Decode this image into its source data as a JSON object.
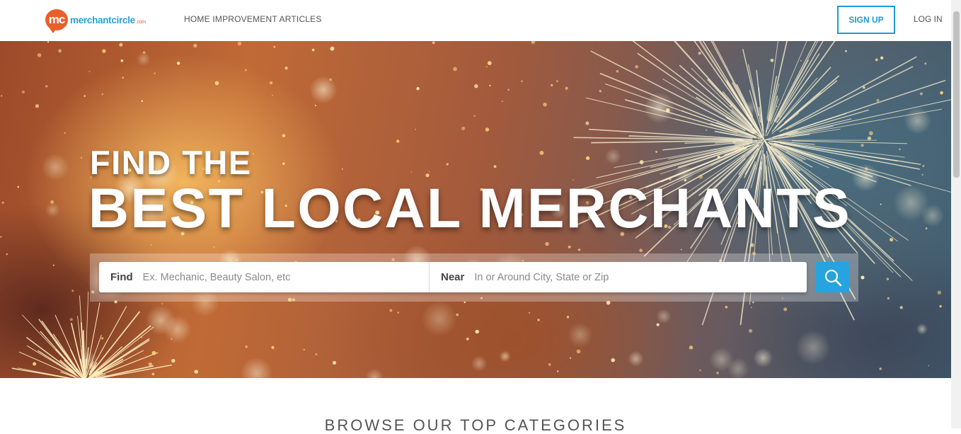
{
  "header": {
    "logo": {
      "badge": "mc",
      "wordmark": "merchantcircle",
      "suffix": ".com"
    },
    "nav": {
      "articles_label": "HOME IMPROVEMENT ARTICLES"
    },
    "signup_label": "SIGN UP",
    "login_label": "LOG IN"
  },
  "hero": {
    "title_line1": "FIND THE",
    "title_line2": "BEST LOCAL MERCHANTS",
    "search": {
      "find_label": "Find",
      "find_placeholder": "Ex. Mechanic, Beauty Salon, etc",
      "near_label": "Near",
      "near_placeholder": "In or Around City, State or Zip",
      "button_icon": "search-icon"
    }
  },
  "categories": {
    "heading": "BROWSE OUR TOP CATEGORIES"
  },
  "colors": {
    "brand_orange": "#e8602c",
    "brand_blue": "#1f9ad6",
    "search_button": "#27a3e0"
  }
}
